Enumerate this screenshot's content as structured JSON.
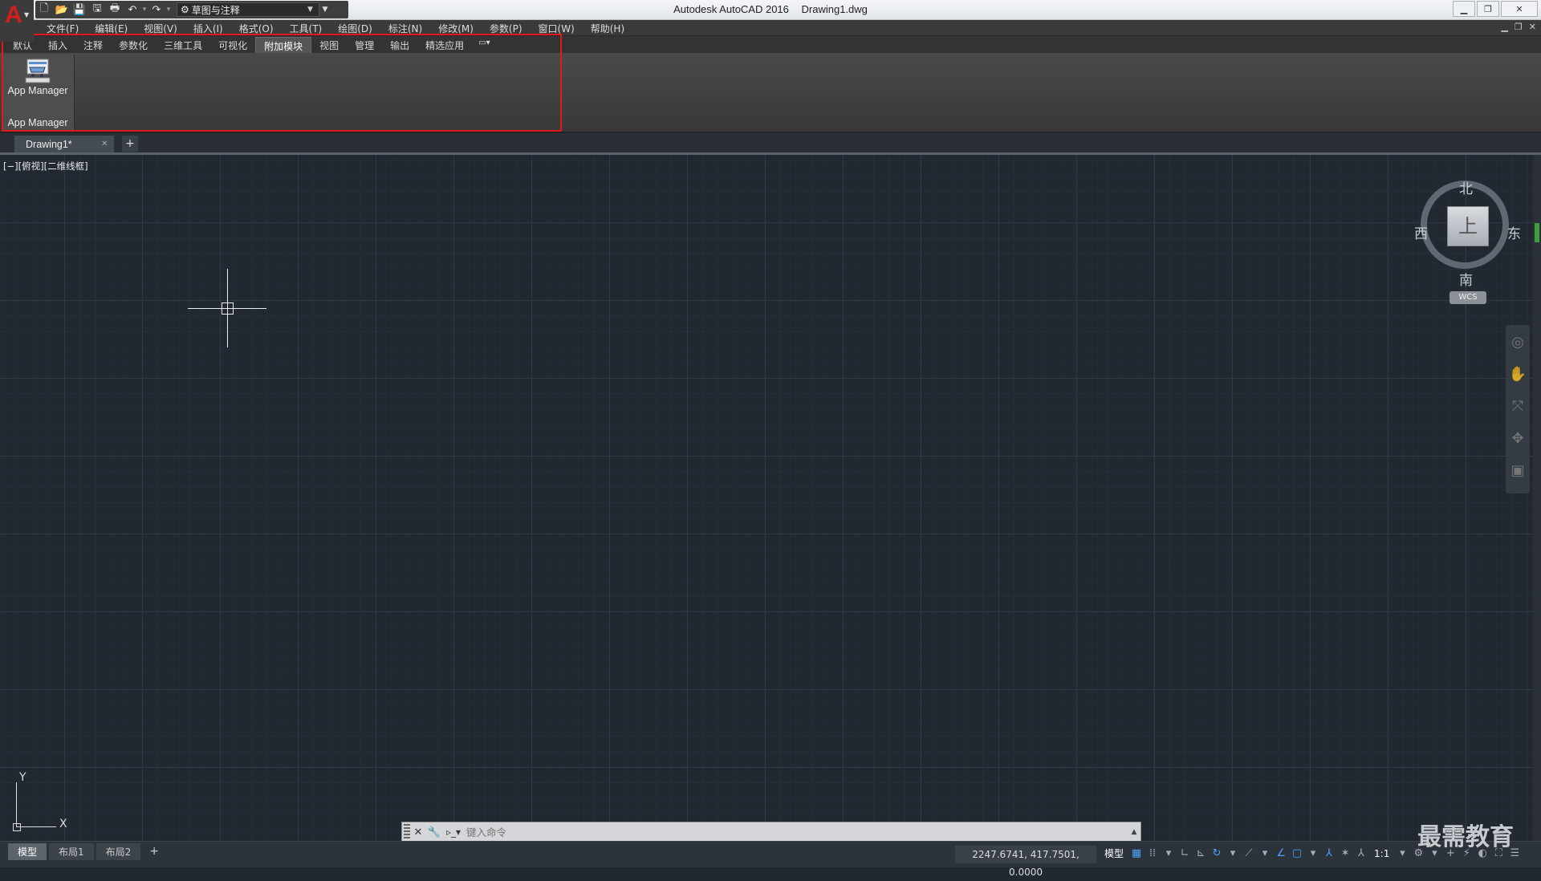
{
  "window": {
    "app_title": "Autodesk AutoCAD 2016",
    "file_title": "Drawing1.dwg",
    "workspace": "草图与注释"
  },
  "menu": [
    "文件(F)",
    "编辑(E)",
    "视图(V)",
    "插入(I)",
    "格式(O)",
    "工具(T)",
    "绘图(D)",
    "标注(N)",
    "修改(M)",
    "参数(P)",
    "窗口(W)",
    "帮助(H)"
  ],
  "ribbon": {
    "tabs": [
      "默认",
      "插入",
      "注释",
      "参数化",
      "三维工具",
      "可视化",
      "附加模块",
      "视图",
      "管理",
      "输出",
      "精选应用"
    ],
    "active_tab": "附加模块",
    "button_label": "App Manager",
    "panel_title": "App Manager"
  },
  "file_tab": {
    "name": "Drawing1*"
  },
  "viewport_label": "[−][俯视][二维线框]",
  "viewcube": {
    "north": "北",
    "south": "南",
    "west": "西",
    "east": "东",
    "face": "上",
    "wcs": "WCS"
  },
  "ucs": {
    "x": "X",
    "y": "Y"
  },
  "command": {
    "placeholder": "键入命令"
  },
  "layouts": [
    "模型",
    "布局1",
    "布局2"
  ],
  "status": {
    "coordinates": "2247.6741, 417.7501, 0.0000",
    "model": "模型",
    "scale": "1:1"
  },
  "watermark": "最需教育",
  "colors": {
    "highlight_box": "#e0191c",
    "canvas": "#212830",
    "logo": "#d41e1e"
  }
}
